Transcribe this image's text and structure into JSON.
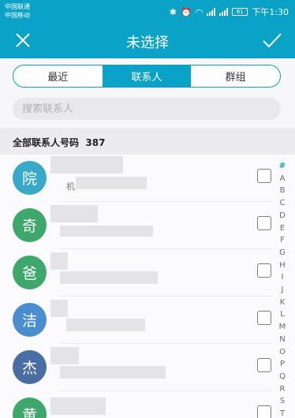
{
  "status_bar": {
    "carrier_1": "中国联通",
    "carrier_2": "中国移动",
    "battery": "61",
    "time": "下午1:30"
  },
  "header": {
    "title": "未选择",
    "close_icon": "close-icon",
    "confirm_icon": "check-icon"
  },
  "tabs": [
    {
      "label": "最近",
      "active": false
    },
    {
      "label": "联系人",
      "active": true
    },
    {
      "label": "群组",
      "active": false
    }
  ],
  "search": {
    "placeholder": "搜索联系人",
    "value": ""
  },
  "list_header": {
    "label": "全部联系人号码",
    "count": "387"
  },
  "contacts": [
    {
      "initial": "院",
      "color": "#39a8c9",
      "snippet": "机",
      "checked": false
    },
    {
      "initial": "奇",
      "color": "#3ea86c",
      "snippet": "",
      "checked": false
    },
    {
      "initial": "爸",
      "color": "#3ea86c",
      "snippet": "",
      "checked": false
    },
    {
      "initial": "洁",
      "color": "#4b8ed0",
      "snippet": "",
      "checked": false
    },
    {
      "initial": "杰",
      "color": "#4a6ea3",
      "snippet": "",
      "checked": false
    },
    {
      "initial": "黄",
      "color": "#3ea86c",
      "snippet": "",
      "checked": false
    }
  ],
  "alphabet_index": [
    "#",
    "A",
    "B",
    "C",
    "D",
    "E",
    "F",
    "G",
    "H",
    "I",
    "J",
    "K",
    "L",
    "M",
    "N",
    "O",
    "P",
    "Q",
    "R",
    "S",
    "T"
  ]
}
